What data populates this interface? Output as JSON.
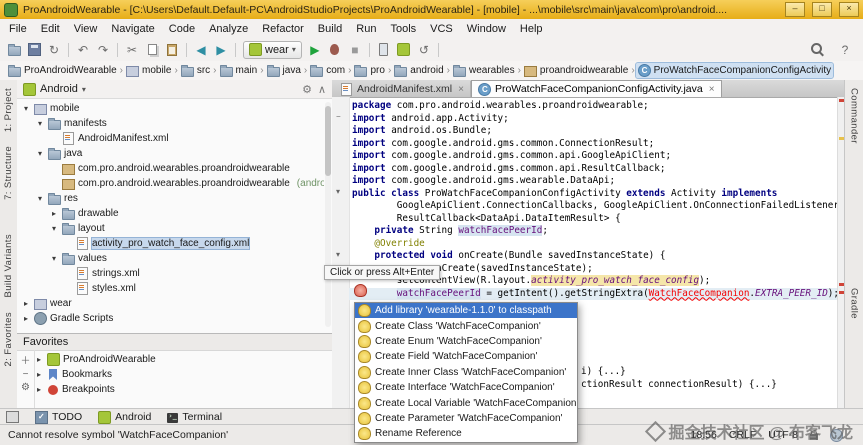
{
  "window": {
    "title": "ProAndroidWearable - [C:\\Users\\Default.Default-PC\\AndroidStudioProjects\\ProAndroidWearable] - [mobile] - ...\\mobile\\src\\main\\java\\com\\pro\\android...."
  },
  "menu_bar": {
    "items": [
      "File",
      "Edit",
      "View",
      "Navigate",
      "Code",
      "Analyze",
      "Refactor",
      "Build",
      "Run",
      "Tools",
      "VCS",
      "Window",
      "Help"
    ]
  },
  "toolbar": {
    "items": [
      {
        "name": "open-file-icon",
        "kind": "folder"
      },
      {
        "name": "save-all-icon",
        "kind": "save"
      },
      {
        "name": "sync-icon",
        "kind": "glyph",
        "glyph": "↻"
      },
      {
        "name": "sep"
      },
      {
        "name": "undo-icon",
        "kind": "glyph",
        "glyph": "↶"
      },
      {
        "name": "redo-icon",
        "kind": "glyph",
        "glyph": "↷"
      },
      {
        "name": "sep"
      },
      {
        "name": "cut-icon",
        "kind": "glyph",
        "glyph": "✂"
      },
      {
        "name": "copy-icon",
        "kind": "copy"
      },
      {
        "name": "paste-icon",
        "kind": "paste"
      },
      {
        "name": "sep"
      },
      {
        "name": "back-icon",
        "kind": "glyph",
        "glyph": "◀",
        "cls": "teal"
      },
      {
        "name": "forward-icon",
        "kind": "glyph",
        "glyph": "▶",
        "cls": "teal"
      },
      {
        "name": "sep"
      },
      {
        "name": "run-config-combo",
        "kind": "combo",
        "label": "wear"
      },
      {
        "name": "run-icon",
        "kind": "glyph",
        "glyph": "▶",
        "cls": "green"
      },
      {
        "name": "debug-icon",
        "kind": "bug"
      },
      {
        "name": "stop-icon",
        "kind": "glyph",
        "glyph": "■",
        "cls": "gray"
      },
      {
        "name": "sep"
      },
      {
        "name": "avd-manager-icon",
        "kind": "phone"
      },
      {
        "name": "sdk-manager-icon",
        "kind": "android"
      },
      {
        "name": "gradle-sync-icon",
        "kind": "glyph",
        "glyph": "↺"
      },
      {
        "name": "sep"
      }
    ],
    "right_items": [
      {
        "name": "search-everywhere-icon",
        "kind": "search"
      },
      {
        "name": "help-icon",
        "kind": "glyph",
        "glyph": "?"
      }
    ]
  },
  "breadcrumb_bar": {
    "items": [
      {
        "label": "ProAndroidWearable",
        "icon": "folder"
      },
      {
        "label": "mobile",
        "icon": "module"
      },
      {
        "label": "src",
        "icon": "folder"
      },
      {
        "label": "main",
        "icon": "folder"
      },
      {
        "label": "java",
        "icon": "folder"
      },
      {
        "label": "com",
        "icon": "folder"
      },
      {
        "label": "pro",
        "icon": "folder"
      },
      {
        "label": "android",
        "icon": "folder"
      },
      {
        "label": "wearables",
        "icon": "folder"
      },
      {
        "label": "proandroidwearable",
        "icon": "package"
      },
      {
        "label": "ProWatchFaceCompanionConfigActivity",
        "icon": "class",
        "selected": true
      }
    ]
  },
  "left_tool_strip": [
    "1: Project",
    "7: Structure",
    "Build Variants",
    "2: Favorites"
  ],
  "right_tool_strip": [
    "Commander",
    "Gradle"
  ],
  "project_panel": {
    "header": {
      "title": "Android"
    },
    "tree": [
      {
        "depth": 0,
        "arrow": "down",
        "icon": "module",
        "label": "mobile"
      },
      {
        "depth": 1,
        "arrow": "down",
        "icon": "folder",
        "label": "manifests"
      },
      {
        "depth": 2,
        "arrow": "none",
        "icon": "xml",
        "label": "AndroidManifest.xml"
      },
      {
        "depth": 1,
        "arrow": "down",
        "icon": "folder",
        "label": "java"
      },
      {
        "depth": 2,
        "arrow": "none",
        "icon": "package",
        "label": "com.pro.android.wearables.proandroidwearable"
      },
      {
        "depth": 2,
        "arrow": "none",
        "icon": "package",
        "label": "com.pro.android.wearables.proandroidwearable",
        "suffix": "(androidTest)"
      },
      {
        "depth": 1,
        "arrow": "down",
        "icon": "folder",
        "label": "res"
      },
      {
        "depth": 2,
        "arrow": "right",
        "icon": "folder",
        "label": "drawable"
      },
      {
        "depth": 2,
        "arrow": "down",
        "icon": "folder",
        "label": "layout"
      },
      {
        "depth": 3,
        "arrow": "none",
        "icon": "xml",
        "label": "activity_pro_watch_face_config.xml",
        "selected": true
      },
      {
        "depth": 2,
        "arrow": "down",
        "icon": "folder",
        "label": "values"
      },
      {
        "depth": 3,
        "arrow": "none",
        "icon": "xml",
        "label": "strings.xml"
      },
      {
        "depth": 3,
        "arrow": "none",
        "icon": "xml",
        "label": "styles.xml"
      },
      {
        "depth": 0,
        "arrow": "right",
        "icon": "module",
        "label": "wear"
      },
      {
        "depth": 0,
        "arrow": "right",
        "icon": "gradle",
        "label": "Gradle Scripts"
      }
    ]
  },
  "favorites_panel": {
    "header": "Favorites",
    "items": [
      {
        "arrow": "right",
        "icon": "android",
        "label": "ProAndroidWearable"
      },
      {
        "arrow": "right",
        "icon": "bookmark",
        "label": "Bookmarks"
      },
      {
        "arrow": "right",
        "icon": "breakpoint",
        "label": "Breakpoints"
      }
    ]
  },
  "editor": {
    "tabs": [
      {
        "label": "AndroidManifest.xml",
        "icon": "xml",
        "active": false
      },
      {
        "label": "ProWatchFaceCompanionConfigActivity.java",
        "icon": "class",
        "active": true
      }
    ],
    "code_lines": [
      {
        "segs": [
          {
            "t": "package ",
            "c": "k"
          },
          {
            "t": "com.pro.android.wearables.proandroidwearable;",
            "c": "p"
          }
        ]
      },
      {
        "segs": [
          {
            "t": "import ",
            "c": "k"
          },
          {
            "t": "android.app.Activity;",
            "c": "p"
          }
        ]
      },
      {
        "segs": [
          {
            "t": "import ",
            "c": "k"
          },
          {
            "t": "android.os.Bundle;",
            "c": "p"
          }
        ]
      },
      {
        "segs": [
          {
            "t": "import ",
            "c": "k"
          },
          {
            "t": "com.google.android.gms.common.ConnectionResult;",
            "c": "p"
          }
        ]
      },
      {
        "segs": [
          {
            "t": "import ",
            "c": "k"
          },
          {
            "t": "com.google.android.gms.common.api.GoogleApiClient;",
            "c": "p"
          }
        ]
      },
      {
        "segs": [
          {
            "t": "import ",
            "c": "k"
          },
          {
            "t": "com.google.android.gms.common.api.ResultCallback;",
            "c": "p"
          }
        ]
      },
      {
        "segs": [
          {
            "t": "import ",
            "c": "k"
          },
          {
            "t": "com.google.android.gms.wearable.DataApi;",
            "c": "p"
          }
        ]
      },
      {
        "segs": [
          {
            "t": "public class ",
            "c": "k"
          },
          {
            "t": "ProWatchFaceCompanionConfigActivity ",
            "c": "p"
          },
          {
            "t": "extends ",
            "c": "k"
          },
          {
            "t": "Activity ",
            "c": "p"
          },
          {
            "t": "implements",
            "c": "k"
          }
        ]
      },
      {
        "segs": [
          {
            "t": "        GoogleApiClient.ConnectionCallbacks, GoogleApiClient.OnConnectionFailedListener,",
            "c": "p"
          }
        ]
      },
      {
        "segs": [
          {
            "t": "        ResultCallback<DataApi.DataItemResult> {",
            "c": "p"
          }
        ]
      },
      {
        "segs": [
          {
            "t": "    ",
            "c": "p"
          },
          {
            "t": "private ",
            "c": "k"
          },
          {
            "t": "String ",
            "c": "p"
          },
          {
            "t": "watchFacePeerId",
            "c": "fh"
          },
          {
            "t": ";",
            "c": "p"
          }
        ]
      },
      {
        "segs": [
          {
            "t": "    @Override",
            "c": "a"
          }
        ]
      },
      {
        "segs": [
          {
            "t": "    ",
            "c": "p"
          },
          {
            "t": "protected void ",
            "c": "k"
          },
          {
            "t": "onCreate(Bundle savedInstanceState) {",
            "c": "p"
          }
        ]
      },
      {
        "segs": [
          {
            "t": "        ",
            "c": "p"
          },
          {
            "t": "super",
            "c": "k"
          },
          {
            "t": ".onCreate(savedInstanceState);",
            "c": "p"
          }
        ]
      },
      {
        "segs": [
          {
            "t": "        setContentView(R.layout.",
            "c": "p"
          },
          {
            "t": "activity_pro_watch_face_config",
            "c": "sfh"
          },
          {
            "t": ");",
            "c": "p"
          }
        ]
      },
      {
        "cls": "caret",
        "segs": [
          {
            "t": "        ",
            "c": "p"
          },
          {
            "t": "watchFacePeerId",
            "c": "fh"
          },
          {
            "t": " = getIntent().getStringExtra(",
            "c": "p"
          },
          {
            "t": "WatchFaceCompanion",
            "c": "e"
          },
          {
            "t": ".",
            "c": "p"
          },
          {
            "t": "EXTRA_PEER_ID",
            "c": "sf"
          },
          {
            "t": ");",
            "c": "p"
          }
        ]
      }
    ],
    "folded_fragments": [
      {
        "text": "i) {...}"
      },
      {
        "text": "ctionResult connectionResult) {...}"
      }
    ]
  },
  "intention_popup": {
    "tooltip": "Click or press Alt+Enter",
    "items": [
      {
        "label": "Add library 'wearable-1.1.0' to classpath",
        "selected": true
      },
      {
        "label": "Create Class 'WatchFaceCompanion'"
      },
      {
        "label": "Create Enum 'WatchFaceCompanion'"
      },
      {
        "label": "Create Field 'WatchFaceCompanion'"
      },
      {
        "label": "Create Inner Class 'WatchFaceCompanion'"
      },
      {
        "label": "Create Interface 'WatchFaceCompanion'"
      },
      {
        "label": "Create Local Variable 'WatchFaceCompanion'"
      },
      {
        "label": "Create Parameter 'WatchFaceCompanion'"
      },
      {
        "label": "Rename Reference"
      }
    ]
  },
  "bottom_tool_bar": {
    "items": [
      {
        "label": "TODO",
        "icon": "todo"
      },
      {
        "label": "Android",
        "icon": "android"
      },
      {
        "label": "Terminal",
        "icon": "terminal"
      }
    ]
  },
  "status_bar": {
    "message": "Cannot resolve symbol 'WatchFaceCompanion'",
    "caret_position": "18:56",
    "line_separator": "CRLF",
    "encoding": "UTF-8"
  },
  "watermark": {
    "text": "掘金技术社区 @ 布客飞龙"
  },
  "colors": {
    "title_gold": "#e8ae18",
    "selection_blue": "#3c74c9",
    "error_red": "#f40000",
    "keyword_navy": "#000080",
    "field_purple": "#660e7a"
  }
}
